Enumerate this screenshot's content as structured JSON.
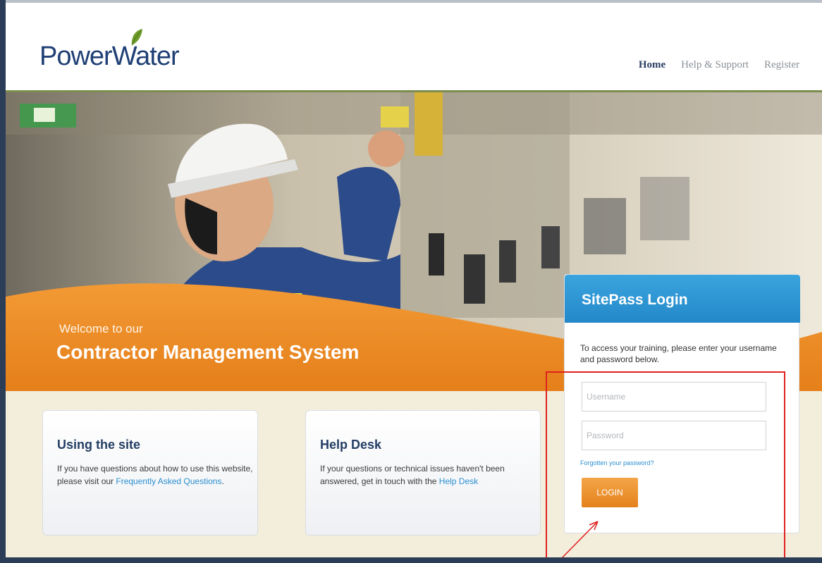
{
  "header": {
    "logo": "PowerWater",
    "nav": [
      {
        "label": "Home",
        "active": true
      },
      {
        "label": "Help & Support",
        "active": false
      },
      {
        "label": "Register",
        "active": false
      }
    ]
  },
  "hero": {
    "welcome_line": "Welcome to our",
    "title": "Contractor Management System"
  },
  "cards": [
    {
      "title": "Using the site",
      "text": "If you have questions about how to use this website, please visit our ",
      "link": "Frequently Asked Questions",
      "suffix": "."
    },
    {
      "title": "Help Desk",
      "text": "If your questions or technical issues haven't been answered, get in touch with the ",
      "link": "Help Desk",
      "suffix": ""
    }
  ],
  "login": {
    "title": "SitePass Login",
    "description": "To access your training, please enter your username and password below.",
    "username_placeholder": "Username",
    "password_placeholder": "Password",
    "forgot": "Forgotten your password?",
    "button": "LOGIN"
  },
  "colors": {
    "brand_navy": "#1f3f75",
    "accent_orange": "#e8841e",
    "login_blue": "#2b92d0",
    "highlight_red": "#e02020"
  },
  "icons": [
    "leaf-icon"
  ]
}
